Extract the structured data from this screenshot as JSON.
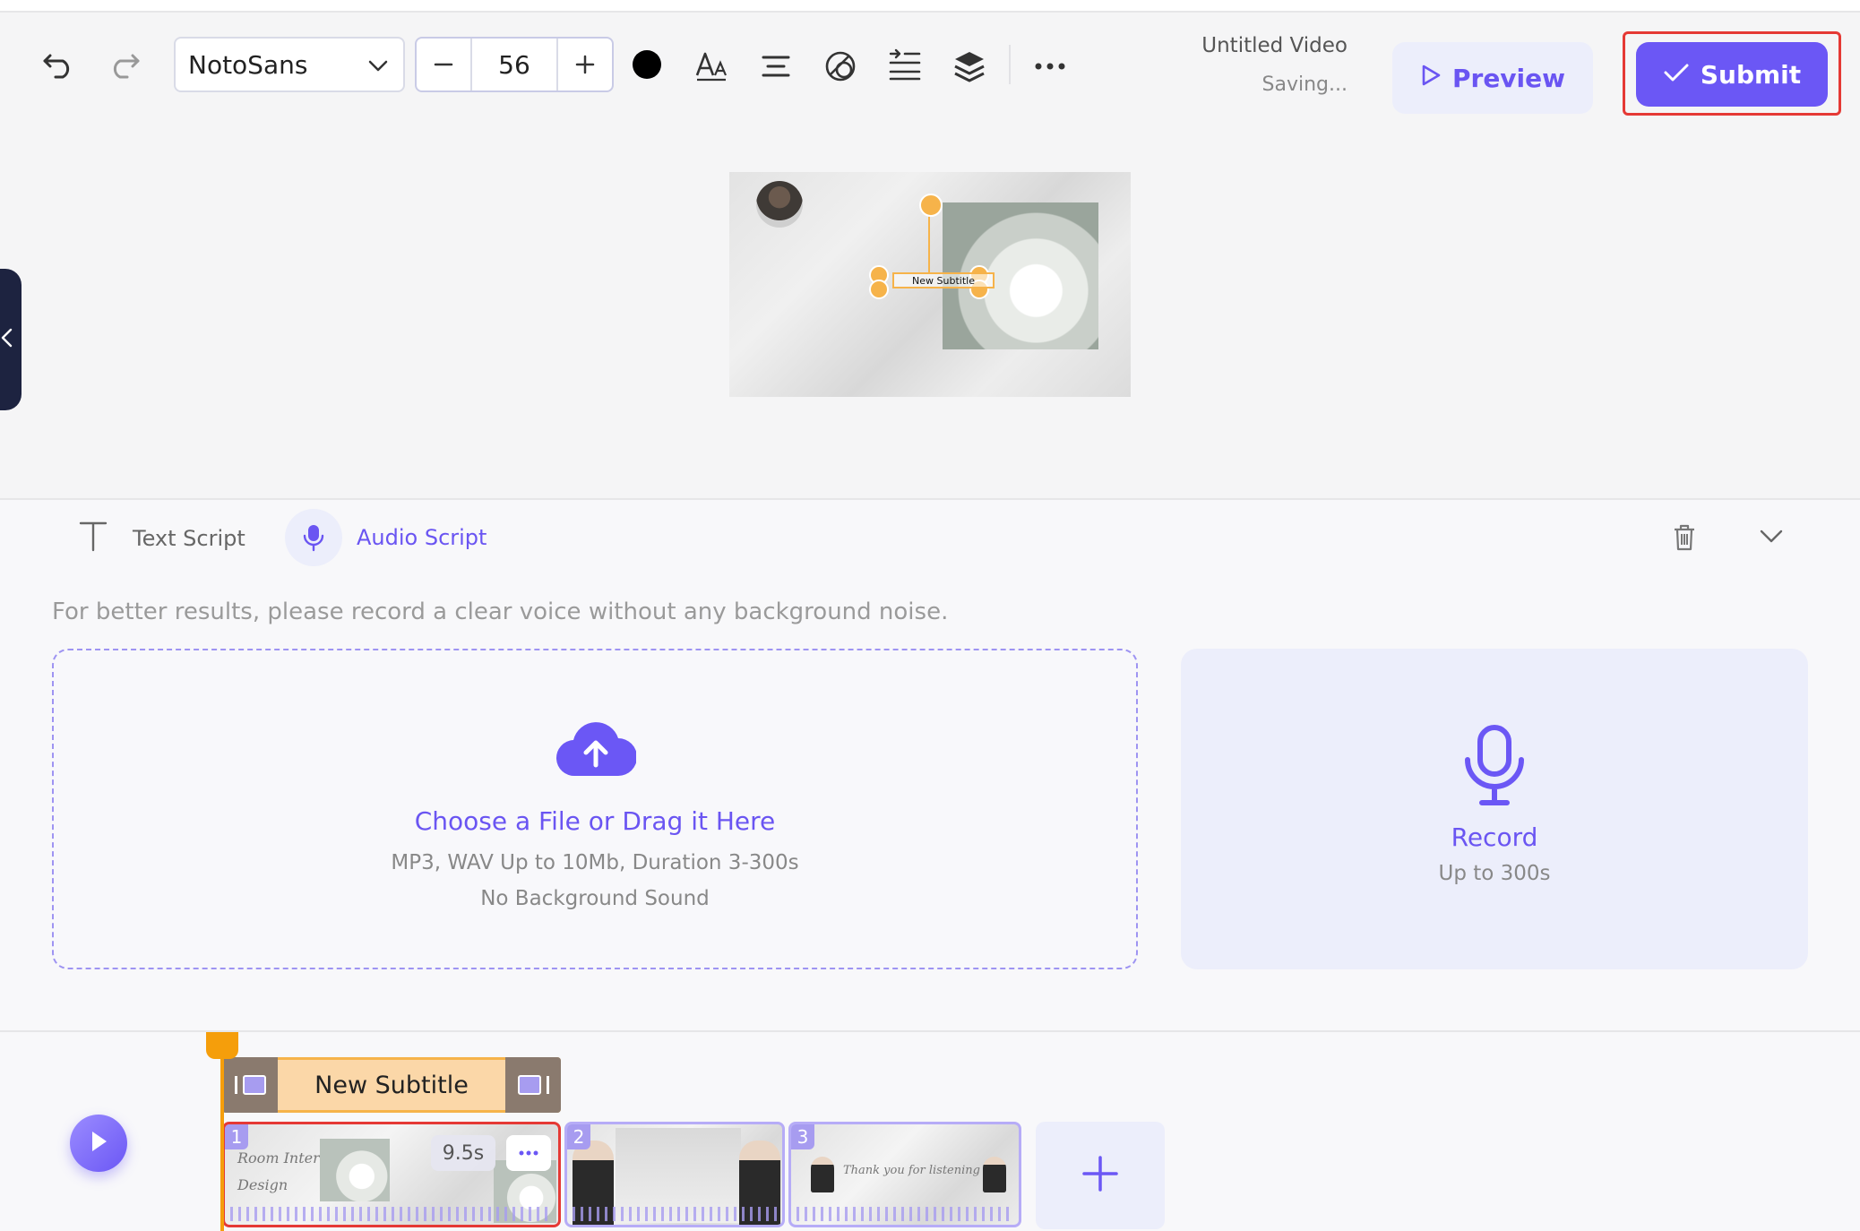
{
  "toolbar": {
    "undo_icon": "undo-icon",
    "redo_icon": "redo-icon",
    "font_family": "NotoSans",
    "font_size": "56",
    "text_color": "#000000",
    "more_icon": "more-horizontal-icon",
    "doc_title": "Untitled Video",
    "doc_status": "Saving...",
    "preview_label": "Preview",
    "submit_label": "Submit"
  },
  "canvas": {
    "subtitle_text": "New Subtitle"
  },
  "script_panel": {
    "tabs": [
      {
        "label": "Text Script",
        "icon": "text-icon",
        "active": false
      },
      {
        "label": "Audio Script",
        "icon": "mic-icon",
        "active": true
      }
    ],
    "hint": "For better results, please record a clear voice without any background noise.",
    "upload": {
      "title": "Choose a File or Drag it Here",
      "line1": "MP3, WAV Up to 10Mb, Duration 3-300s",
      "line2": "No Background Sound"
    },
    "record": {
      "title": "Record",
      "subtitle": "Up to 300s"
    }
  },
  "timeline": {
    "subtitle_track": "New Subtitle",
    "clips": [
      {
        "number": "1",
        "duration": "9.5s",
        "selected": true
      },
      {
        "number": "2",
        "selected": false
      },
      {
        "number": "3",
        "selected": false
      }
    ],
    "thumb_text": {
      "clip1_title_a": "Room Interior",
      "clip1_title_b": "Design",
      "clip3_text": "Thank you for listening"
    }
  },
  "colors": {
    "accent": "#6b57f5",
    "highlight": "#e53935",
    "subtitle_handle": "#f6b34a",
    "playhead": "#f59e0b"
  }
}
